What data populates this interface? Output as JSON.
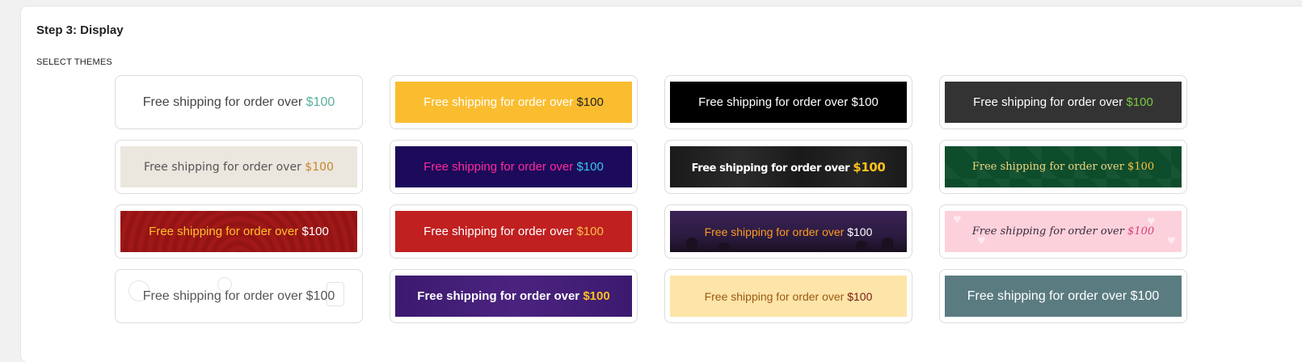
{
  "step": {
    "title": "Step 3: Display"
  },
  "section": {
    "label": "SELECT THEMES"
  },
  "themes": [
    {
      "text": "Free shipping for order over ",
      "amount": "$100"
    },
    {
      "text": "Free shipping for order over ",
      "amount": "$100"
    },
    {
      "text": "Free shipping for order over ",
      "amount": "$100"
    },
    {
      "text": "Free shipping for order over ",
      "amount": "$100"
    },
    {
      "text": "Free shipping for order over ",
      "amount": "$100"
    },
    {
      "text": "Free shipping for order over ",
      "amount": "$100"
    },
    {
      "text": "Free shipping for order over ",
      "amount": "$100"
    },
    {
      "text": "Free shipping for order over ",
      "amount": "$100"
    },
    {
      "text": "Free shipping for order over ",
      "amount": "$100"
    },
    {
      "text": "Free shipping for order over ",
      "amount": "$100"
    },
    {
      "text": "Free shipping for order over ",
      "amount": "$100"
    },
    {
      "text": "Free shipping for order over ",
      "amount": "$100"
    },
    {
      "text": "Free shipping for order over ",
      "amount": "$100"
    },
    {
      "text": "Free shipping for order over ",
      "amount": "$100"
    },
    {
      "text": "Free shipping for order over ",
      "amount": "$100"
    },
    {
      "text": "Free shipping for order over ",
      "amount": "$100"
    }
  ],
  "colors": {
    "page_bg": "#f1f1f1",
    "panel_bg": "#ffffff",
    "card_border": "#dcdcdc"
  }
}
